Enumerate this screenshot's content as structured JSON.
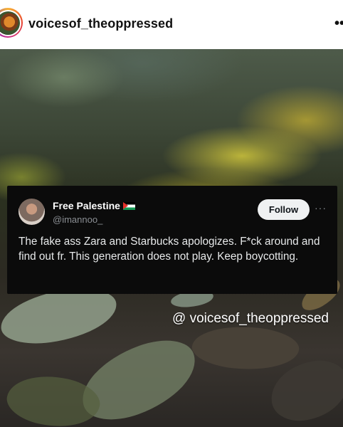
{
  "post": {
    "username": "voicesof_theoppressed",
    "more_icon": "more-dots-icon",
    "more_glyph": "••"
  },
  "tweet": {
    "name": "Free Palestine",
    "handle": "@imannoo_",
    "follow_label": "Follow",
    "more_glyph": "···",
    "text": "The fake ass Zara and Starbucks apologizes. F*ck around and find out fr. This generation does not play. Keep boycotting."
  },
  "watermark": {
    "text": "@ voicesof_theoppressed"
  }
}
